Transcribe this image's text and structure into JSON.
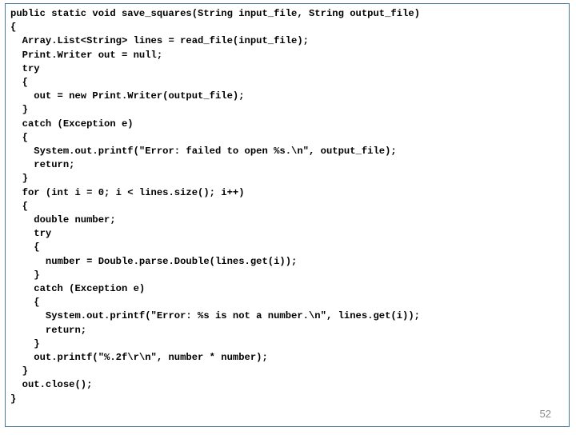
{
  "page_number": "52",
  "code_lines": [
    "public static void save_squares(String input_file, String output_file)",
    "{",
    "  Array.List<String> lines = read_file(input_file);",
    "  Print.Writer out = null;",
    "  try",
    "  {",
    "    out = new Print.Writer(output_file);",
    "  }",
    "  catch (Exception e)",
    "  {",
    "    System.out.printf(\"Error: failed to open %s.\\n\", output_file);",
    "    return;",
    "  }",
    "  for (int i = 0; i < lines.size(); i++)",
    "  {",
    "    double number;",
    "    try",
    "    {",
    "      number = Double.parse.Double(lines.get(i));",
    "    }",
    "    catch (Exception e)",
    "    {",
    "      System.out.printf(\"Error: %s is not a number.\\n\", lines.get(i));",
    "      return;",
    "    }",
    "    out.printf(\"%.2f\\r\\n\", number * number);",
    "  }",
    "  out.close();",
    "}"
  ]
}
